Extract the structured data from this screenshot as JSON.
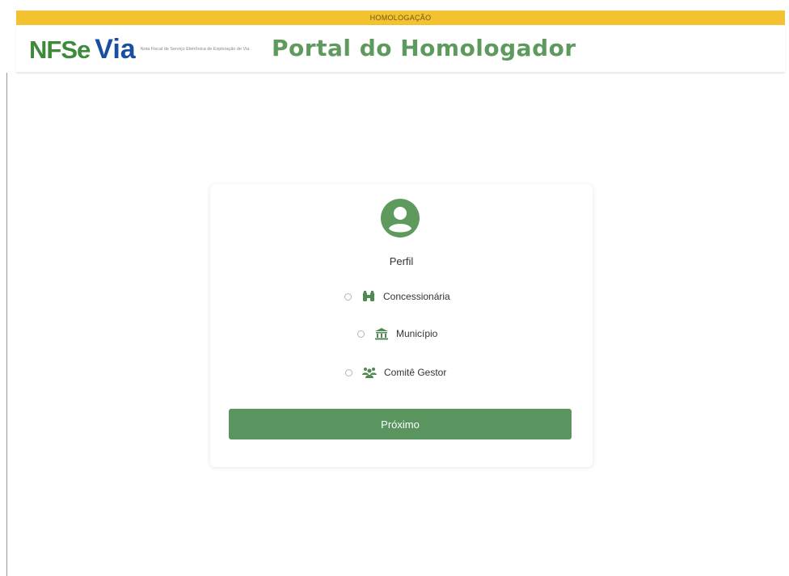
{
  "environment_banner": "HOMOLOGAÇÃO",
  "header": {
    "logo": {
      "nfse_text": "NFSe",
      "via_text": "Via",
      "tagline": "Nota Fiscal de Serviço Eletrônica de Exploração de Via"
    },
    "title": "Portal do Homologador"
  },
  "card": {
    "profile_label": "Perfil",
    "options": [
      {
        "label": "Concessionária",
        "icon": "binoculars-icon",
        "selected": false
      },
      {
        "label": "Município",
        "icon": "landmark-icon",
        "selected": false
      },
      {
        "label": "Comitê Gestor",
        "icon": "users-icon",
        "selected": false
      }
    ],
    "next_button_label": "Próximo"
  },
  "colors": {
    "banner": "#f4c22f",
    "brand_green": "#5e9a5e",
    "button": "#5a9560",
    "logo_blue": "#1a4fa0"
  }
}
